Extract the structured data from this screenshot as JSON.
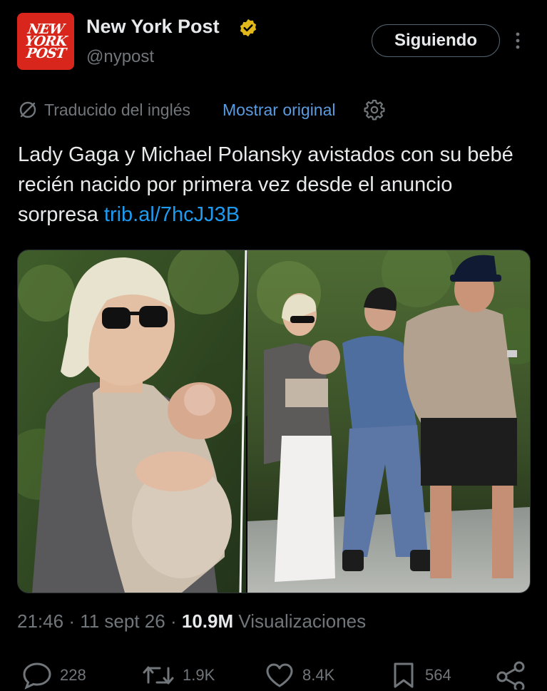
{
  "account": {
    "avatar_lines": [
      "NEW",
      "YORK",
      "POST"
    ],
    "name": "New York Post",
    "handle": "@nypost",
    "follow_label": "Siguiendo"
  },
  "translation": {
    "label": "Traducido del inglés",
    "show_original": "Mostrar original"
  },
  "tweet": {
    "text": "Lady Gaga y Michael Polansky avistados con su bebé recién nacido por primera vez desde el anuncio sorpresa ",
    "link": "trib.al/7hcJJ3B"
  },
  "meta": {
    "time": "21:46",
    "separator": "·",
    "date": "11 sept 26",
    "views_count": "10.9M",
    "views_label": "Visualizaciones"
  },
  "actions": {
    "replies": "228",
    "reposts": "1.9K",
    "likes": "8.4K",
    "bookmarks": "564"
  },
  "colors": {
    "background": "#000000",
    "text": "#e7e9ea",
    "muted": "#71767b",
    "link": "#1d9bf0",
    "brand": "#d9261c",
    "verified": "#e2b719"
  },
  "icons": [
    "verified-badge-icon",
    "more-vertical-icon",
    "translate-icon",
    "gear-icon",
    "reply-icon",
    "repost-icon",
    "like-icon",
    "bookmark-icon",
    "share-icon"
  ]
}
